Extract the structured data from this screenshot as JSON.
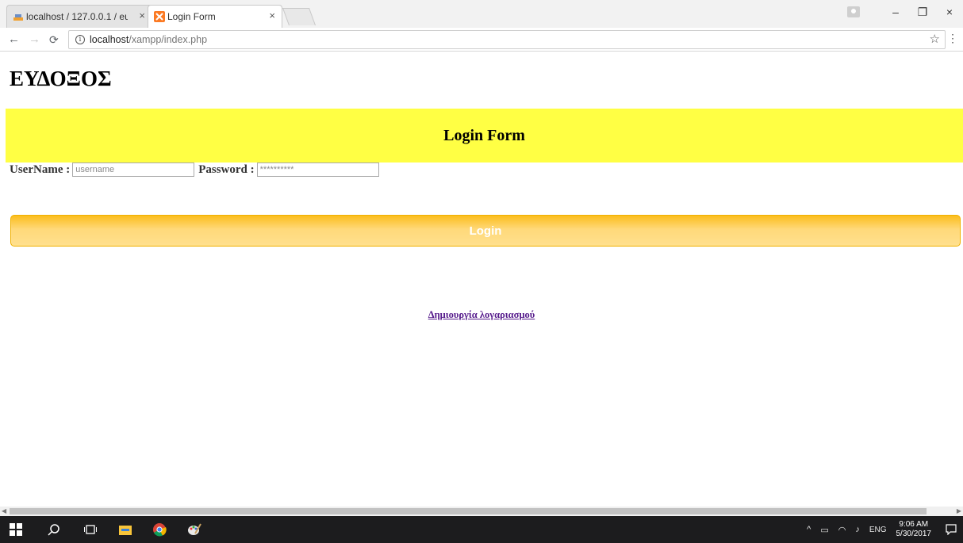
{
  "browser": {
    "tabs": [
      {
        "title": "localhost / 127.0.0.1 / eu",
        "active": false
      },
      {
        "title": "Login Form",
        "active": true
      }
    ],
    "tab_close_glyph": "×",
    "url_host": "localhost",
    "url_path": "/xampp/index.php",
    "window_controls": [
      "–",
      "❐",
      "×"
    ]
  },
  "page": {
    "site_title": "ΕΥΔΟΞΟΣ",
    "banner_title": "Login Form",
    "username_label": "UserName :",
    "username_placeholder": "username",
    "password_label": "Password :",
    "password_placeholder": "**********",
    "login_button": "Login",
    "signup_link": "Δημιουργία λογαριασμού"
  },
  "colors": {
    "banner": "#ffff44",
    "button_top": "#fbbd1c",
    "button_bottom": "#ffe08e",
    "link": "#551a8b"
  },
  "taskbar": {
    "language": "ENG",
    "time": "9:06 AM",
    "date": "5/30/2017"
  }
}
